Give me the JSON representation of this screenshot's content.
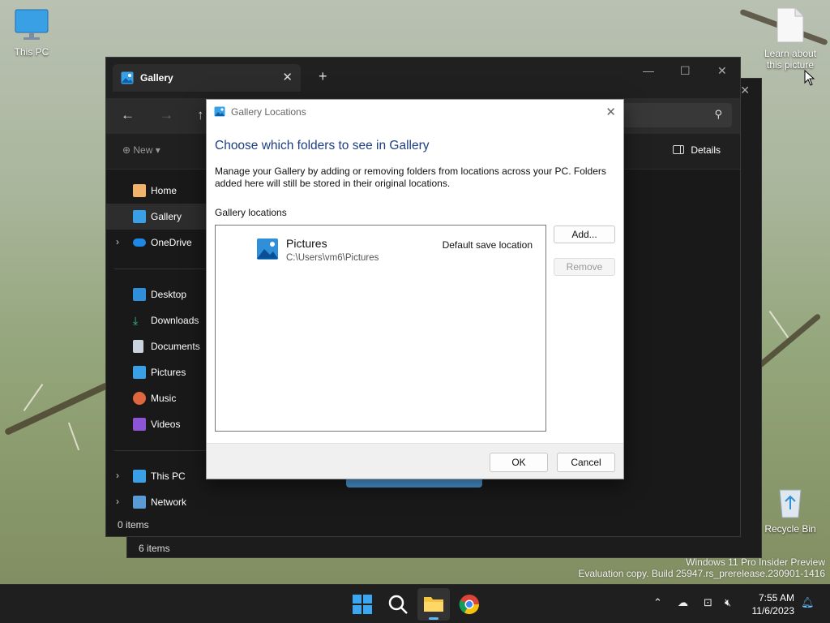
{
  "desktop": {
    "icons": [
      {
        "label": "This PC"
      },
      {
        "label": "Learn about this picture"
      },
      {
        "label": "Recycle Bin"
      }
    ]
  },
  "explorer": {
    "tab_title": "Gallery",
    "new_label": "New",
    "details_label": "Details",
    "nav": [
      {
        "label": "Home"
      },
      {
        "label": "Gallery"
      },
      {
        "label": "OneDrive"
      },
      {
        "label": "Desktop"
      },
      {
        "label": "Downloads"
      },
      {
        "label": "Documents"
      },
      {
        "label": "Pictures"
      },
      {
        "label": "Music"
      },
      {
        "label": "Videos"
      },
      {
        "label": "This PC"
      },
      {
        "label": "Network"
      }
    ],
    "status": "0 items",
    "back_status": "6 items"
  },
  "dialog": {
    "title": "Gallery Locations",
    "heading": "Choose which folders to see in Gallery",
    "description": "Manage your Gallery by adding or removing folders from locations across your PC. Folders added here will still be stored in their original locations.",
    "list_label": "Gallery locations",
    "locations": [
      {
        "name": "Pictures",
        "path": "C:\\Users\\vm6\\Pictures",
        "badge": "Default save location"
      }
    ],
    "add_label": "Add...",
    "remove_label": "Remove",
    "ok_label": "OK",
    "cancel_label": "Cancel"
  },
  "watermark": {
    "line1": "Windows 11 Pro Insider Preview",
    "line2": "Evaluation copy. Build 25947.rs_prerelease.230901-1416"
  },
  "taskbar": {
    "time": "7:55 AM",
    "date": "11/6/2023"
  },
  "colors": {
    "accent": "#0067c0",
    "heading": "#1e3e82",
    "explorer_bg": "#191919"
  }
}
